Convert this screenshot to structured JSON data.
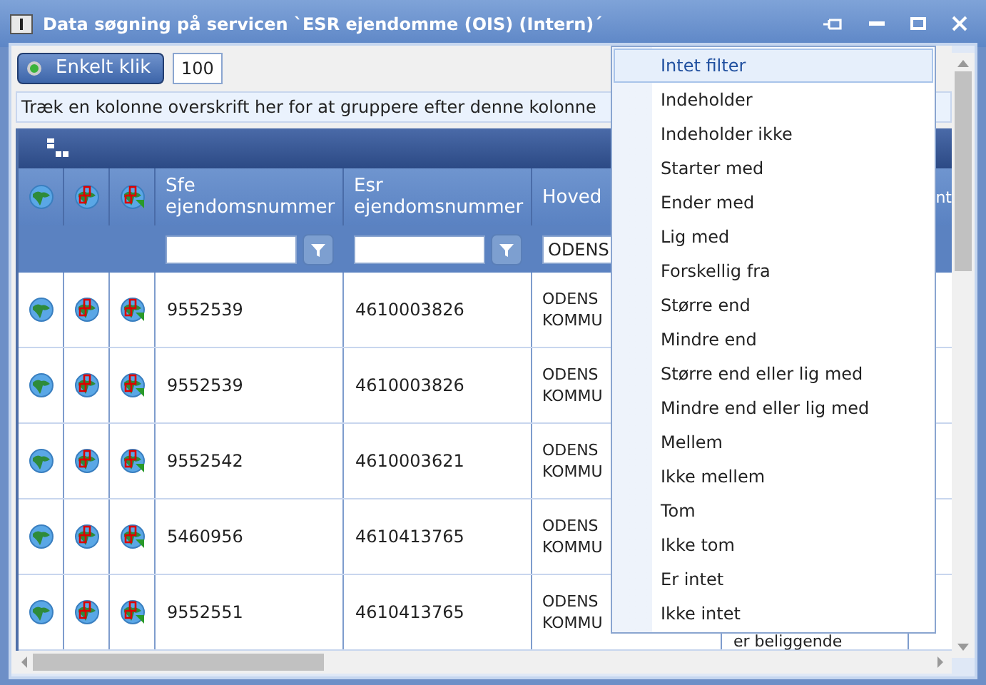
{
  "window": {
    "title": "Data søgning på servicen `ESR ejendomme (OIS) (Intern)´"
  },
  "toolbar": {
    "mode_button": "Enkelt klik",
    "page_size": "100"
  },
  "group_panel": "Træk en kolonne overskrift her for at gruppere efter denne kolonne",
  "columns": [
    {
      "label": "Sfe ejendomsnummer",
      "kind": "filter"
    },
    {
      "label": "Esr ejendomsnummer",
      "kind": "filter"
    },
    {
      "label": "Hoved",
      "kind": "value",
      "filter_value": "ODENS"
    }
  ],
  "column_8_heading": "nt",
  "rows": [
    {
      "sfe": "9552539",
      "esr": "4610003826",
      "hoved": [
        "ODENS",
        "KOMMU"
      ]
    },
    {
      "sfe": "9552539",
      "esr": "4610003826",
      "hoved": [
        "ODENS",
        "KOMMU"
      ]
    },
    {
      "sfe": "9552542",
      "esr": "4610003621",
      "hoved": [
        "ODENS",
        "KOMMU"
      ]
    },
    {
      "sfe": "5460956",
      "esr": "4610413765",
      "hoved": [
        "ODENS",
        "KOMMU"
      ]
    },
    {
      "sfe": "9552551",
      "esr": "4610413765",
      "hoved": [
        "ODENS",
        "KOMMU"
      ],
      "column_7": "er beliggende"
    }
  ],
  "filter_menu": [
    {
      "label": "Intet filter",
      "selected": true
    },
    {
      "label": "Indeholder",
      "selected": false
    },
    {
      "label": "Indeholder ikke",
      "selected": false
    },
    {
      "label": "Starter med",
      "selected": false
    },
    {
      "label": "Ender med",
      "selected": false
    },
    {
      "label": "Lig med",
      "selected": false
    },
    {
      "label": "Forskellig fra",
      "selected": false
    },
    {
      "label": "Større end",
      "selected": false
    },
    {
      "label": "Mindre end",
      "selected": false
    },
    {
      "label": "Større end eller lig med",
      "selected": false
    },
    {
      "label": "Mindre end eller lig med",
      "selected": false
    },
    {
      "label": "Mellem",
      "selected": false
    },
    {
      "label": "Ikke mellem",
      "selected": false
    },
    {
      "label": "Tom",
      "selected": false
    },
    {
      "label": "Ikke tom",
      "selected": false
    },
    {
      "label": "Er intet",
      "selected": false
    },
    {
      "label": "Ikke intet",
      "selected": false
    }
  ]
}
